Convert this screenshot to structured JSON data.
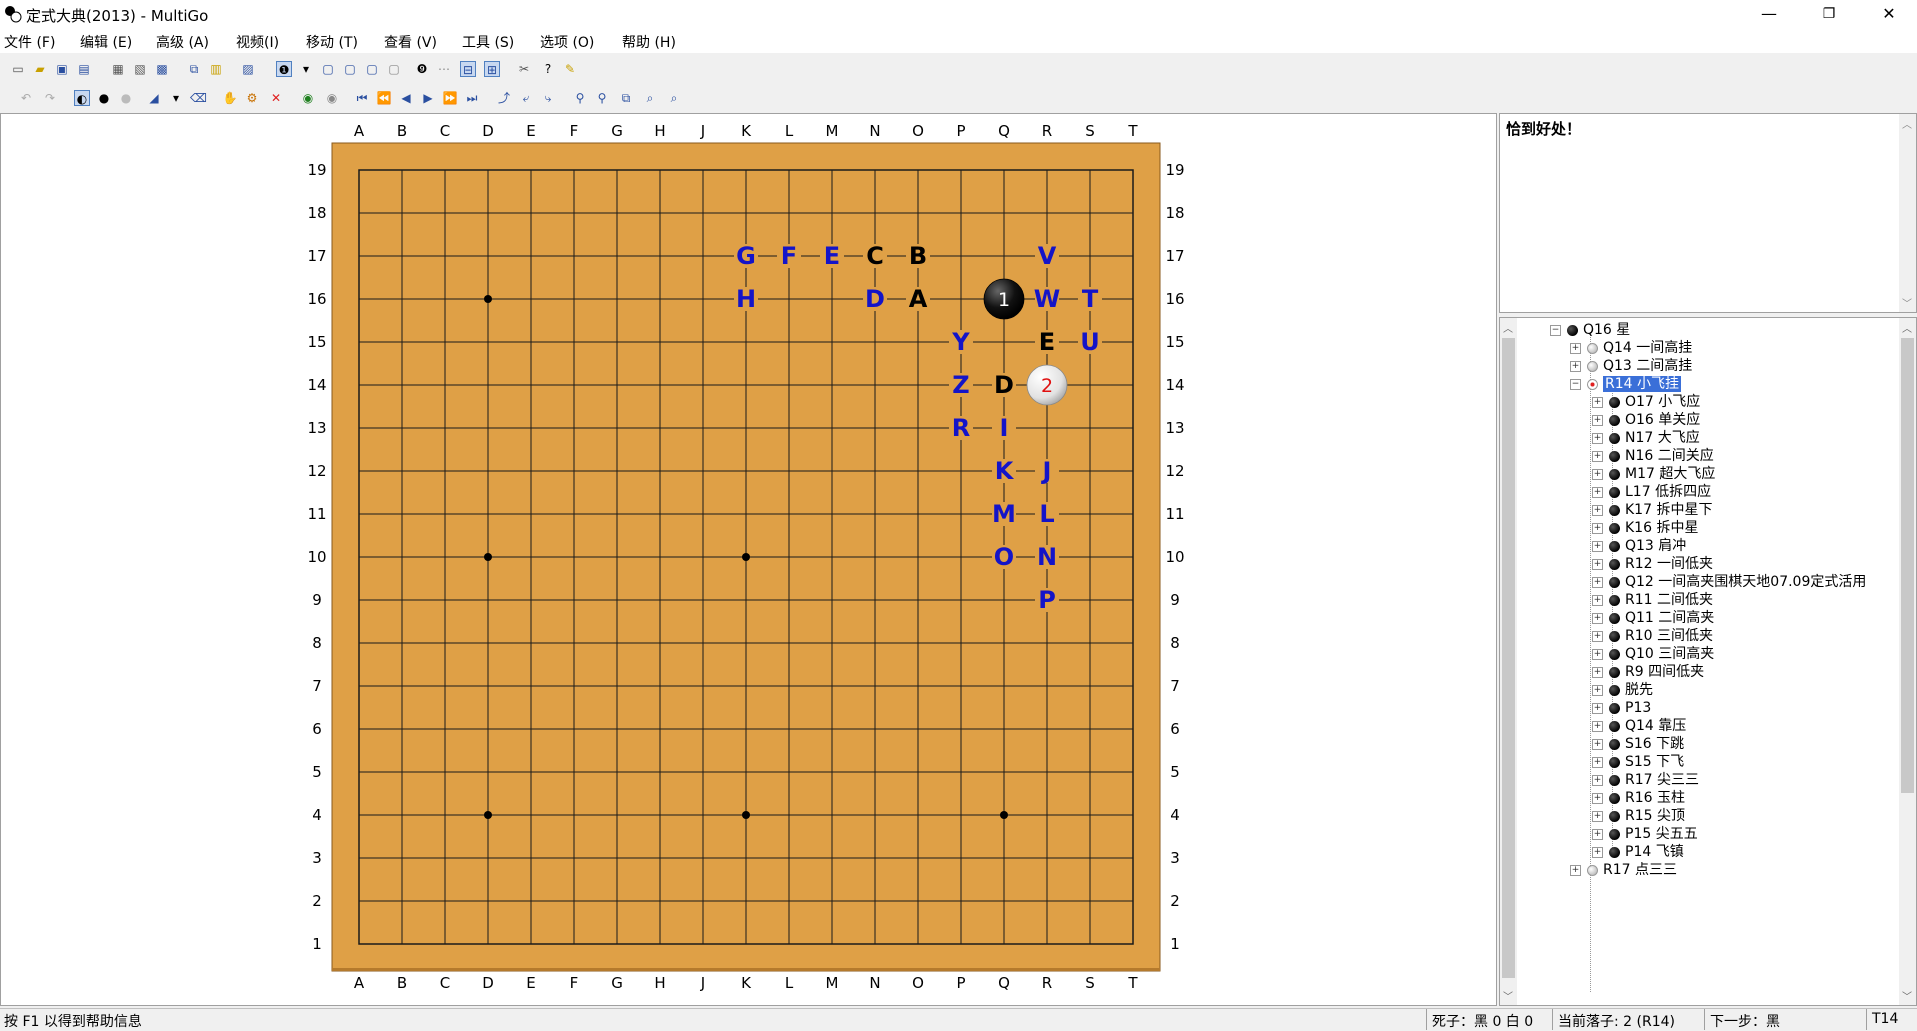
{
  "window": {
    "title": "定式大典(2013) - MultiGo",
    "minimize": "—",
    "restore": "❐",
    "close": "✕"
  },
  "menu": [
    {
      "label": "文件 (F)"
    },
    {
      "label": "编辑 (E)"
    },
    {
      "label": "高级 (A)"
    },
    {
      "label": "视频(I)"
    },
    {
      "label": "移动 (T)"
    },
    {
      "label": "查看 (V)"
    },
    {
      "label": "工具 (S)"
    },
    {
      "label": "选项 (O)"
    },
    {
      "label": "帮助 (H)"
    }
  ],
  "board": {
    "columns": [
      "A",
      "B",
      "C",
      "D",
      "E",
      "F",
      "G",
      "H",
      "J",
      "K",
      "L",
      "M",
      "N",
      "O",
      "P",
      "Q",
      "R",
      "S",
      "T"
    ],
    "rows": [
      "19",
      "18",
      "17",
      "16",
      "15",
      "14",
      "13",
      "12",
      "11",
      "10",
      "9",
      "8",
      "7",
      "6",
      "5",
      "4",
      "3",
      "2",
      "1"
    ],
    "hoshi": [
      "D16",
      "D10",
      "K10",
      "D4",
      "K4",
      "Q4"
    ],
    "stones": [
      {
        "point": "Q16",
        "color": "black",
        "number": "1"
      },
      {
        "point": "R14",
        "color": "white",
        "number": "2"
      }
    ],
    "marks": [
      {
        "point": "K17",
        "text": "G",
        "color": "blue"
      },
      {
        "point": "L17",
        "text": "F",
        "color": "blue"
      },
      {
        "point": "M17",
        "text": "E",
        "color": "blue"
      },
      {
        "point": "N17",
        "text": "C",
        "color": "black"
      },
      {
        "point": "O17",
        "text": "B",
        "color": "black"
      },
      {
        "point": "R17",
        "text": "V",
        "color": "blue"
      },
      {
        "point": "K16",
        "text": "H",
        "color": "blue"
      },
      {
        "point": "N16",
        "text": "D",
        "color": "blue"
      },
      {
        "point": "O16",
        "text": "A",
        "color": "black"
      },
      {
        "point": "R16",
        "text": "W",
        "color": "blue"
      },
      {
        "point": "S16",
        "text": "T",
        "color": "blue"
      },
      {
        "point": "P15",
        "text": "Y",
        "color": "blue"
      },
      {
        "point": "R15",
        "text": "E",
        "color": "black"
      },
      {
        "point": "S15",
        "text": "U",
        "color": "blue"
      },
      {
        "point": "P14",
        "text": "Z",
        "color": "blue"
      },
      {
        "point": "Q14",
        "text": "D",
        "color": "black"
      },
      {
        "point": "P13",
        "text": "R",
        "color": "blue"
      },
      {
        "point": "Q13",
        "text": "I",
        "color": "blue"
      },
      {
        "point": "Q12",
        "text": "K",
        "color": "blue"
      },
      {
        "point": "R12",
        "text": "J",
        "color": "blue"
      },
      {
        "point": "Q11",
        "text": "M",
        "color": "blue"
      },
      {
        "point": "R11",
        "text": "L",
        "color": "blue"
      },
      {
        "point": "Q10",
        "text": "O",
        "color": "blue"
      },
      {
        "point": "R10",
        "text": "N",
        "color": "blue"
      },
      {
        "point": "R9",
        "text": "P",
        "color": "blue"
      }
    ],
    "colors": {
      "wood": "#dfa046",
      "line": "#1a1a1a",
      "blue_mark": "#1414c8",
      "white_number": "#e01010"
    }
  },
  "comment": {
    "text": "恰到好处！"
  },
  "tree": {
    "root": {
      "label": "Q16 星",
      "stone": "black"
    },
    "level1": [
      {
        "label": "Q14 一间高挂",
        "stone": "white",
        "expander": "+"
      },
      {
        "label": "Q13 二间高挂",
        "stone": "white",
        "expander": "+"
      },
      {
        "label": "R14 小飞挂",
        "stone": "white-red",
        "expander": "−",
        "selected": true
      }
    ],
    "children": [
      {
        "label": "O17 小飞应"
      },
      {
        "label": "O16 单关应"
      },
      {
        "label": "N17 大飞应"
      },
      {
        "label": "N16 二间关应"
      },
      {
        "label": "M17 超大飞应"
      },
      {
        "label": "L17 低拆四应"
      },
      {
        "label": "K17 拆中星下"
      },
      {
        "label": "K16 拆中星"
      },
      {
        "label": "Q13 肩冲"
      },
      {
        "label": "R12 一间低夹"
      },
      {
        "label": "Q12 一间高夹围棋天地07.09定式活用"
      },
      {
        "label": "R11 二间低夹"
      },
      {
        "label": "Q11 二间高夹"
      },
      {
        "label": "R10 三间低夹"
      },
      {
        "label": "Q10 三间高夹"
      },
      {
        "label": "R9 四间低夹"
      },
      {
        "label": "脱先"
      },
      {
        "label": "P13"
      },
      {
        "label": "Q14 靠压"
      },
      {
        "label": "S16 下跳"
      },
      {
        "label": "S15 下飞"
      },
      {
        "label": "R17 尖三三"
      },
      {
        "label": "R16 玉柱"
      },
      {
        "label": "R15 尖顶"
      },
      {
        "label": "P15 尖五五"
      },
      {
        "label": "P14 飞镇"
      }
    ],
    "last": {
      "label": "R17 点三三",
      "stone": "white",
      "expander": "+"
    }
  },
  "status": {
    "help": "按 F1 以得到帮助信息",
    "captures": "死子：黑 0 白 0",
    "current_move": "当前落子: 2 (R14)",
    "next_move": "下一步：黑",
    "cursor": "T14"
  }
}
